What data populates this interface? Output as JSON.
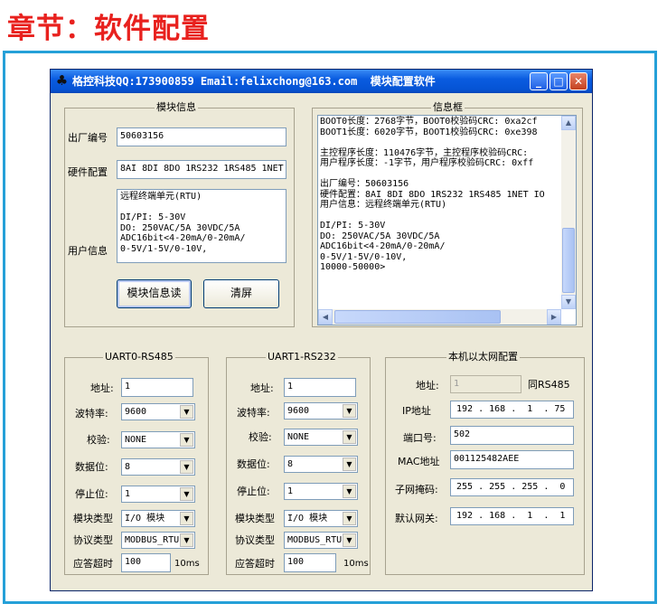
{
  "heading": "章节：软件配置",
  "window": {
    "title": "格控科技QQ:173900859 Email:felixchong@163.com  模块配置软件",
    "controls": {
      "minimize": "_",
      "maximize": "□",
      "close": "✕"
    }
  },
  "module_info": {
    "group_label": "模块信息",
    "serial_label": "出厂编号",
    "serial_value": "50603156",
    "hardware_label": "硬件配置",
    "hardware_value": "8AI 8DI 8DO 1RS232 1RS485 1NET",
    "user_label": "用户信息",
    "user_value": "远程终端单元(RTU)\n\nDI/PI: 5-30V\nDO: 250VAC/5A 30VDC/5A\nADC16bit<4-20mA/0-20mA/\n0-5V/1-5V/0-10V,",
    "read_button": "模块信息读",
    "clear_button": "清屏"
  },
  "info_box": {
    "group_label": "信息框",
    "text": "BOOT0长度：2768字节，BOOT0校验码CRC: 0xa2cf\nBOOT1长度：6020字节，BOOT1校验码CRC: 0xe398\n\n主控程序长度：110476字节，主控程序校验码CRC:\n用户程序长度：-1字节，用户程序校验码CRC: 0xff\n\n出厂编号：50603156\n硬件配置：8AI 8DI 8DO 1RS232 1RS485 1NET IO\n用户信息：远程终端单元(RTU)\n\nDI/PI: 5-30V\nDO: 250VAC/5A 30VDC/5A\nADC16bit<4-20mA/0-20mA/\n0-5V/1-5V/0-10V,\n10000-50000>"
  },
  "uart0": {
    "group_label": "UART0-RS485",
    "address_label": "地址:",
    "address_value": "1",
    "baud_label": "波特率:",
    "baud_value": "9600",
    "parity_label": "校验:",
    "parity_value": "NONE",
    "databits_label": "数据位:",
    "databits_value": "8",
    "stopbits_label": "停止位:",
    "stopbits_value": "1",
    "module_type_label": "模块类型",
    "module_type_value": "I/O 模块",
    "protocol_label": "协议类型",
    "protocol_value": "MODBUS_RTU",
    "timeout_label": "应答超时",
    "timeout_value": "100",
    "timeout_unit": "10ms"
  },
  "uart1": {
    "group_label": "UART1-RS232",
    "address_label": "地址:",
    "address_value": "1",
    "baud_label": "波特率:",
    "baud_value": "9600",
    "parity_label": "校验:",
    "parity_value": "NONE",
    "databits_label": "数据位:",
    "databits_value": "8",
    "stopbits_label": "停止位:",
    "stopbits_value": "1",
    "module_type_label": "模块类型",
    "module_type_value": "I/O 模块",
    "protocol_label": "协议类型",
    "protocol_value": "MODBUS_RTU",
    "timeout_label": "应答超时",
    "timeout_value": "100",
    "timeout_unit": "10ms"
  },
  "ethernet": {
    "group_label": "本机以太网配置",
    "address_label": "地址:",
    "address_value": "1",
    "same_as": "同RS485",
    "ip_label": "IP地址",
    "ip_value": "192 . 168 .  1  . 75",
    "port_label": "端口号:",
    "port_value": "502",
    "mac_label": "MAC地址",
    "mac_value": "001125482AEE",
    "mask_label": "子网掩码:",
    "mask_value": "255 . 255 . 255 .  0",
    "gateway_label": "默认网关:",
    "gateway_value": "192 . 168 .  1  .  1"
  },
  "icons": {
    "app": "app-icon",
    "dropdown": "triangle-down"
  }
}
